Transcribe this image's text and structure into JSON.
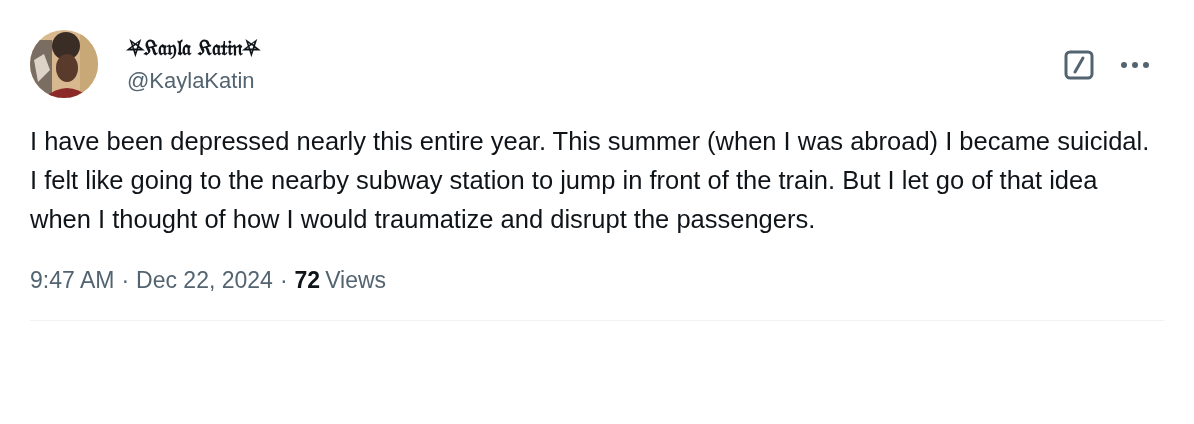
{
  "author": {
    "display_name": "⛧𝔎𝔞𝔶𝔩𝔞 𝔎𝔞𝔱𝔦𝔫⛧",
    "handle": "@KaylaKatin"
  },
  "text": "I have been depressed nearly this entire year. This summer (when I was abroad) I became suicidal. I felt like going to the nearby subway station to jump in front of the train. But I let go of that idea when I thought of how I would traumatize and disrupt the passengers.",
  "meta": [
    {
      "kind": "time",
      "text": "9:47 AM"
    },
    {
      "kind": "separator",
      "text": "·"
    },
    {
      "kind": "date",
      "text": "Dec 22, 2024"
    },
    {
      "kind": "separator",
      "text": "·"
    },
    {
      "kind": "count",
      "text": "72"
    },
    {
      "kind": "label",
      "text": "Views"
    }
  ]
}
